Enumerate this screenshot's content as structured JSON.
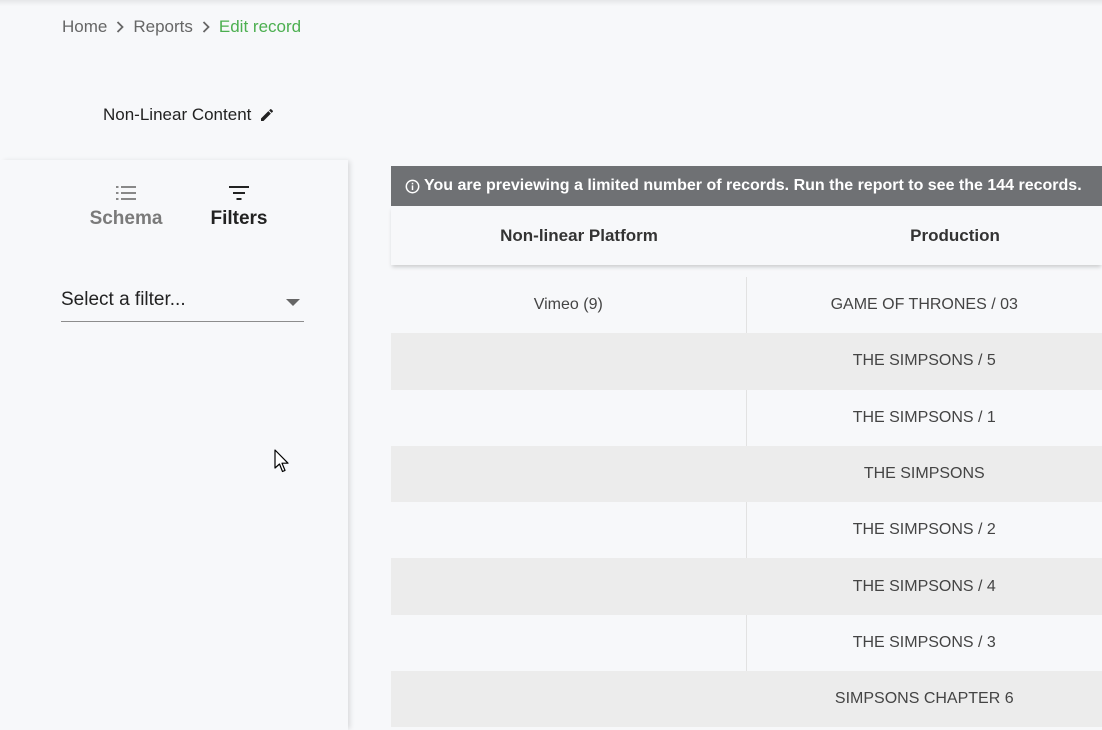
{
  "breadcrumb": {
    "items": [
      {
        "label": "Home"
      },
      {
        "label": "Reports"
      },
      {
        "label": "Edit record"
      }
    ]
  },
  "report": {
    "title": "Non-Linear Content"
  },
  "tabs": {
    "schema": {
      "label": "Schema",
      "icon": "list-icon"
    },
    "filters": {
      "label": "Filters",
      "icon": "filter-icon"
    }
  },
  "filter_select": {
    "placeholder": "Select a filter..."
  },
  "banner": {
    "icon": "info-icon",
    "text": "You are previewing a limited number of records. Run the report to see the 144 records."
  },
  "table": {
    "columns": [
      "Non-linear Platform",
      "Production"
    ],
    "rows": [
      [
        "Vimeo (9)",
        "GAME OF THRONES / 03"
      ],
      [
        "",
        "THE SIMPSONS / 5"
      ],
      [
        "",
        "THE SIMPSONS / 1"
      ],
      [
        "",
        "THE SIMPSONS"
      ],
      [
        "",
        "THE SIMPSONS / 2"
      ],
      [
        "",
        "THE SIMPSONS / 4"
      ],
      [
        "",
        "THE SIMPSONS / 3"
      ],
      [
        "",
        "SIMPSONS CHAPTER 6"
      ]
    ]
  },
  "colors": {
    "accent": "#4caf50",
    "banner_bg": "#6f7174"
  }
}
